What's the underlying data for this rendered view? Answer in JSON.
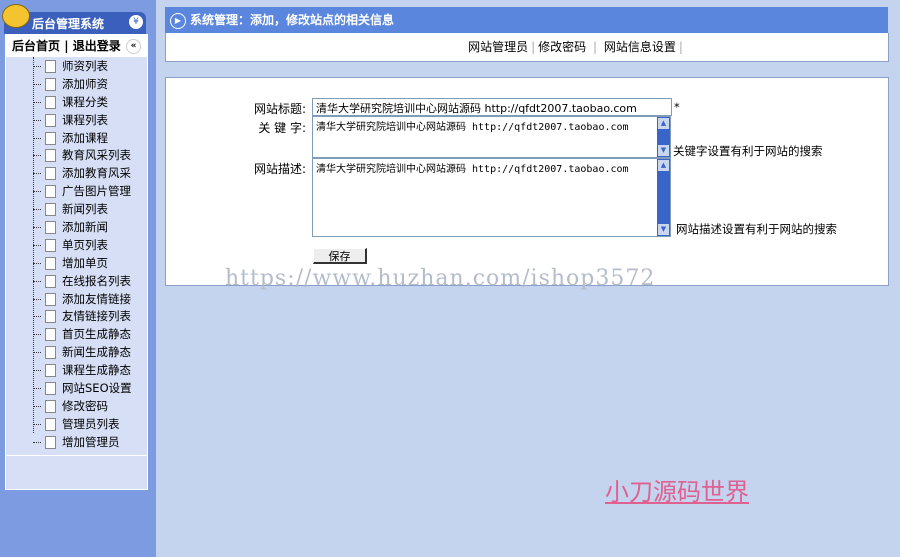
{
  "app": {
    "title": "后台管理系统"
  },
  "nav": {
    "home": "后台首页",
    "sep": "|",
    "logout": "退出登录"
  },
  "menu": [
    "师资列表",
    "添加师资",
    "课程分类",
    "课程列表",
    "添加课程",
    "教育风采列表",
    "添加教育风采",
    "广告图片管理",
    "新闻列表",
    "添加新闻",
    "单页列表",
    "增加单页",
    "在线报名列表",
    "添加友情链接",
    "友情链接列表",
    "首页生成静态",
    "新闻生成静态",
    "课程生成静态",
    "网站SEO设置",
    "修改密码",
    "管理员列表",
    "增加管理员"
  ],
  "header": {
    "title": "系统管理：添加，修改站点的相关信息"
  },
  "links": [
    "网站管理员",
    "修改密码",
    "网站信息设置"
  ],
  "form": {
    "title_label": "网站标题:",
    "title_value": "清华大学研究院培训中心网站源码  http://qfdt2007.taobao.com",
    "required": "*",
    "keywords_label": "关 键 字:",
    "keywords_value": "清华大学研究院培训中心网站源码 http://qfdt2007.taobao.com",
    "keywords_hint": "关键字设置有利于网站的搜索",
    "desc_label": "网站描述:",
    "desc_value": "清华大学研究院培训中心网站源码 http://qfdt2007.taobao.com",
    "desc_hint": "网站描述设置有利于网站的搜索",
    "save": "保存"
  },
  "watermark": "https://www.huzhan.com/ishop3572",
  "brand": "小刀源码世界"
}
